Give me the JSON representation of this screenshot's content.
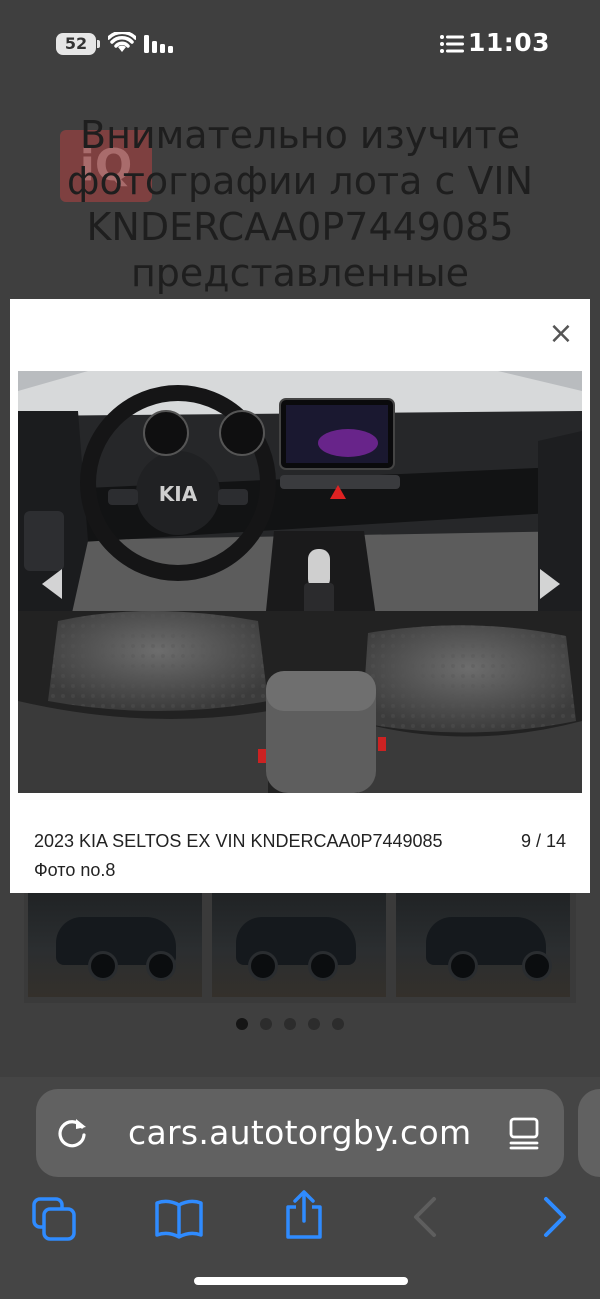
{
  "status_bar": {
    "battery_level": "52",
    "time": "11:03"
  },
  "background_page": {
    "heading": "Внимательно изучите фотографии лота с VIN KNDERCAA0P7449085 представленные",
    "logo_text": "iQ",
    "carousel": {
      "total_dots": 5,
      "active_dot": 0
    }
  },
  "modal": {
    "close_label": "×",
    "caption": "2023 KIA SELTOS EX VIN KNDERCAA0P7449085 Фото no.8",
    "counter": "9 / 14",
    "photo_alt": "Interior: dashboard, steering wheel with KIA logo, front seats"
  },
  "browser": {
    "url": "cars.autotorgby.com",
    "toolbar": [
      "tabs-icon",
      "bookmarks-icon",
      "share-icon",
      "back-icon",
      "forward-icon"
    ]
  },
  "colors": {
    "accent_blue": "#2f8bff",
    "overlay_gray": "#3f3f3f"
  }
}
